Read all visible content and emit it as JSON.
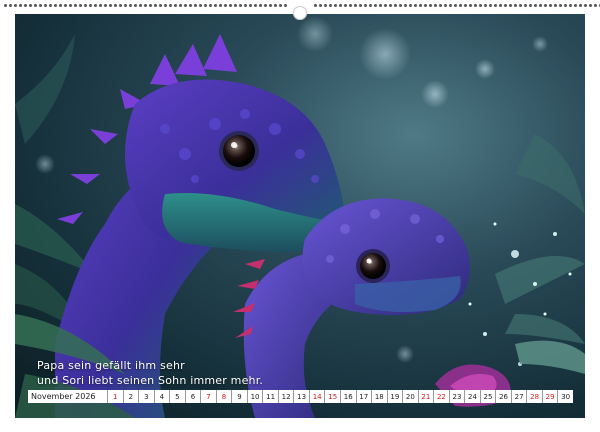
{
  "caption": {
    "line1": "Papa sein gefällt ihm sehr",
    "line2": "und Sori liebt seinen Sohn immer mehr."
  },
  "calendar": {
    "month_label": "November 2026",
    "days": [
      "1",
      "2",
      "3",
      "4",
      "5",
      "6",
      "7",
      "8",
      "9",
      "10",
      "11",
      "12",
      "13",
      "14",
      "15",
      "16",
      "17",
      "18",
      "19",
      "20",
      "21",
      "22",
      "23",
      "24",
      "25",
      "26",
      "27",
      "28",
      "29",
      "30"
    ],
    "red_days": [
      "1",
      "7",
      "8",
      "14",
      "15",
      "21",
      "22",
      "28",
      "29"
    ]
  },
  "colors": {
    "weekend_red": "#d11a1a",
    "dino_purple": "#4b3fb8",
    "dino_teal": "#2f7f8a"
  }
}
